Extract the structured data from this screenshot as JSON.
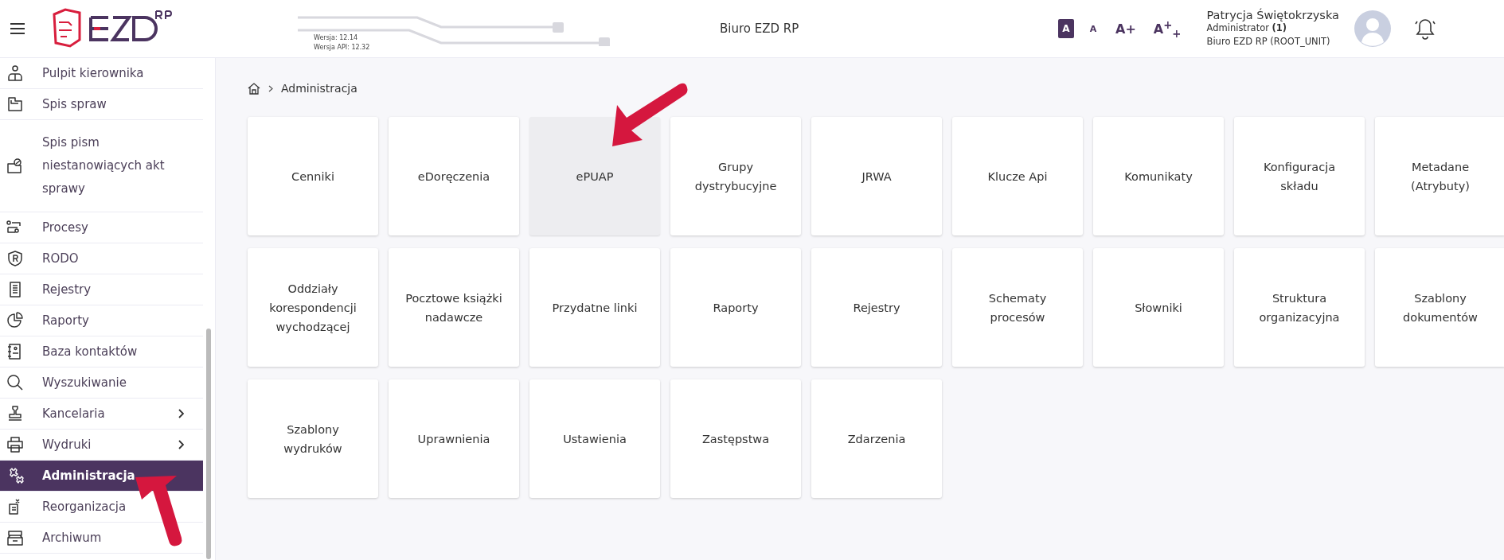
{
  "header": {
    "version": "Wersja: 12.14",
    "api_version": "Wersja API: 12.32",
    "office": "Biuro EZD RP",
    "font_sizes": [
      {
        "label": "A",
        "selected": true
      },
      {
        "label": "A",
        "selected": false
      },
      {
        "label": "A+",
        "selected": false
      },
      {
        "label": "A$^{+}$$_{+}$",
        "selected": false
      }
    ],
    "user": {
      "name": "Patrycja Świętokrzyska",
      "role": "Administrator **(1)**",
      "unit": "Biuro EZD RP (ROOT_UNIT)"
    }
  },
  "sidebar": {
    "items": [
      {
        "label": "Pulpit kierownika",
        "selected": false,
        "has_submenu": false
      },
      {
        "label": "Spis spraw",
        "selected": false,
        "has_submenu": false
      },
      {
        "label": "Spis pism niestanowiących akt sprawy",
        "selected": false,
        "has_submenu": false
      },
      {
        "label": "Procesy",
        "selected": false,
        "has_submenu": false
      },
      {
        "label": "RODO",
        "selected": false,
        "has_submenu": false
      },
      {
        "label": "Rejestry",
        "selected": false,
        "has_submenu": false
      },
      {
        "label": "Raporty",
        "selected": false,
        "has_submenu": false
      },
      {
        "label": "Baza kontaktów",
        "selected": false,
        "has_submenu": false
      },
      {
        "label": "Wyszukiwanie",
        "selected": false,
        "has_submenu": false
      },
      {
        "label": "Kancelaria",
        "selected": false,
        "has_submenu": true
      },
      {
        "label": "Wydruki",
        "selected": false,
        "has_submenu": true
      },
      {
        "label": "Administracja",
        "selected": true,
        "has_submenu": false
      },
      {
        "label": "Reorganizacja",
        "selected": false,
        "has_submenu": false
      },
      {
        "label": "Archiwum",
        "selected": false,
        "has_submenu": false
      }
    ]
  },
  "breadcrumb": [
    "Administracja"
  ],
  "tiles": [
    {
      "label": "Cenniki",
      "highlighted": false
    },
    {
      "label": "eDoręczenia",
      "highlighted": false
    },
    {
      "label": "ePUAP",
      "highlighted": true
    },
    {
      "label": "Grupy dystrybucyjne",
      "highlighted": false
    },
    {
      "label": "JRWA",
      "highlighted": false
    },
    {
      "label": "Klucze Api",
      "highlighted": false
    },
    {
      "label": "Komunikaty",
      "highlighted": false
    },
    {
      "label": "Konfiguracja składu",
      "highlighted": false
    },
    {
      "label": "Metadane (Atrybuty)",
      "highlighted": false
    },
    {
      "label": "Oddziały korespondencji wychodzącej",
      "highlighted": false
    },
    {
      "label": "Pocztowe książki nadawcze",
      "highlighted": false
    },
    {
      "label": "Przydatne linki",
      "highlighted": false
    },
    {
      "label": "Raporty",
      "highlighted": false
    },
    {
      "label": "Rejestry",
      "highlighted": false
    },
    {
      "label": "Schematy procesów",
      "highlighted": false
    },
    {
      "label": "Słowniki",
      "highlighted": false
    },
    {
      "label": "Struktura organizacyjna",
      "highlighted": false
    },
    {
      "label": "Szablony dokumentów",
      "highlighted": false
    },
    {
      "label": "Szablony wydruków",
      "highlighted": false
    },
    {
      "label": "Uprawnienia",
      "highlighted": false
    },
    {
      "label": "Ustawienia",
      "highlighted": false
    },
    {
      "label": "Zastępstwa",
      "highlighted": false
    },
    {
      "label": "Zdarzenia",
      "highlighted": false
    }
  ]
}
